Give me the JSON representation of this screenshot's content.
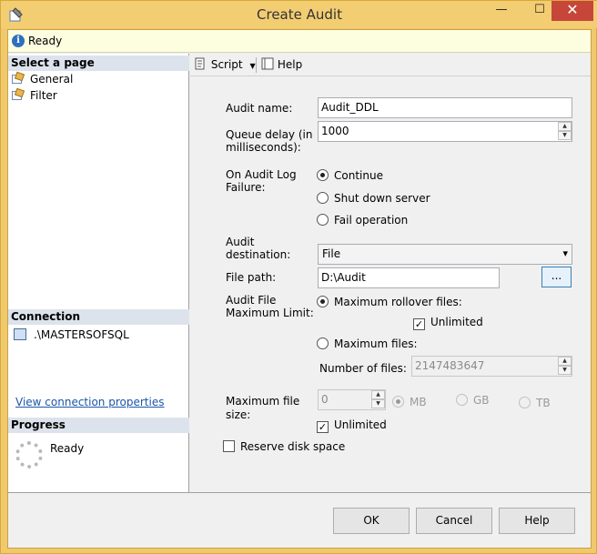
{
  "window": {
    "title": "Create Audit",
    "minimize": "—",
    "maximize": "☐",
    "close": "✕"
  },
  "status": {
    "icon": "info-icon",
    "text": "Ready"
  },
  "select_page": {
    "header": "Select a page",
    "items": [
      {
        "label": "General",
        "icon": "page-wrench-icon"
      },
      {
        "label": "Filter",
        "icon": "page-wrench-icon"
      }
    ]
  },
  "connection": {
    "header": "Connection",
    "server": ".\\MASTERSOFSQL",
    "link": "View connection properties"
  },
  "progress": {
    "header": "Progress",
    "text": "Ready"
  },
  "toolbar": {
    "script_label": "Script",
    "help_label": "Help"
  },
  "form": {
    "audit_name_label": "Audit name:",
    "audit_name_value": "Audit_DDL",
    "queue_delay_label_1": "Queue delay (in",
    "queue_delay_label_2": "milliseconds):",
    "queue_delay_value": "1000",
    "on_failure_label_1": "On Audit Log",
    "on_failure_label_2": "Failure:",
    "on_failure_options": [
      {
        "label": "Continue",
        "selected": true
      },
      {
        "label": "Shut down server",
        "selected": false
      },
      {
        "label": "Fail operation",
        "selected": false
      }
    ],
    "destination_label_1": "Audit",
    "destination_label_2": "destination:",
    "destination_value": "File",
    "file_path_label": "File path:",
    "file_path_value": "D:\\Audit",
    "browse_label": "...",
    "max_limit_label_1": "Audit File",
    "max_limit_label_2": "Maximum Limit:",
    "max_rollover_label": "Maximum rollover files:",
    "max_rollover_selected": true,
    "rollover_unlimited_label": "Unlimited",
    "rollover_unlimited_checked": true,
    "max_files_label": "Maximum files:",
    "max_files_selected": false,
    "number_of_files_label": "Number of files:",
    "number_of_files_value": "2147483647",
    "max_file_size_label_1": "Maximum file",
    "max_file_size_label_2": "size:",
    "max_file_size_value": "0",
    "size_units": [
      {
        "label": "MB",
        "selected": true
      },
      {
        "label": "GB",
        "selected": false
      },
      {
        "label": "TB",
        "selected": false
      }
    ],
    "size_unlimited_label": "Unlimited",
    "size_unlimited_checked": true,
    "reserve_disk_label": "Reserve disk space",
    "reserve_disk_checked": false
  },
  "buttons": {
    "ok": "OK",
    "cancel": "Cancel",
    "help": "Help"
  }
}
